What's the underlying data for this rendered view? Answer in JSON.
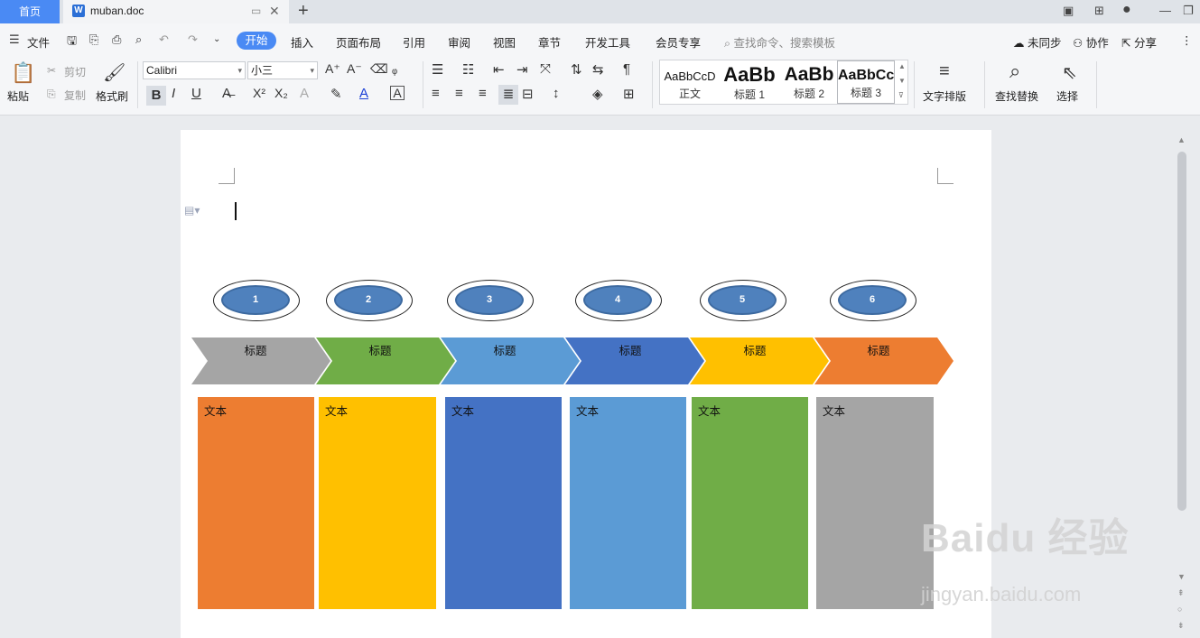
{
  "titlebar": {
    "home_tab": "首页",
    "doc_tab": "muban.doc",
    "doc_icon": "W",
    "new_tab": "+"
  },
  "menu": {
    "file": "文件",
    "tabs": [
      "开始",
      "插入",
      "页面布局",
      "引用",
      "审阅",
      "视图",
      "章节",
      "开发工具",
      "会员专享"
    ],
    "search_placeholder": "查找命令、搜索模板",
    "right": [
      "未同步",
      "协作",
      "分享"
    ]
  },
  "ribbon": {
    "paste": "粘贴",
    "cut": "剪切",
    "copy": "复制",
    "format_painter": "格式刷",
    "font_name": "Calibri",
    "font_size": "小三",
    "styles": [
      {
        "sample": "AaBbCcD",
        "name": "正文"
      },
      {
        "sample": "AaBb",
        "name": "标题 1"
      },
      {
        "sample": "AaBb",
        "name": "标题 2"
      },
      {
        "sample": "AaBbCc",
        "name": "标题 3"
      }
    ],
    "text_layout": "文字排版",
    "find_replace": "查找替换",
    "select": "选择"
  },
  "diagram": {
    "steps": [
      {
        "num": "1",
        "title": "标题",
        "text": "文本"
      },
      {
        "num": "2",
        "title": "标题",
        "text": "文本"
      },
      {
        "num": "3",
        "title": "标题",
        "text": "文本"
      },
      {
        "num": "4",
        "title": "标题",
        "text": "文本"
      },
      {
        "num": "5",
        "title": "标题",
        "text": "文本"
      },
      {
        "num": "6",
        "title": "标题",
        "text": "文本"
      }
    ],
    "chevron_colors": [
      "#a5a5a5",
      "#70ad47",
      "#5b9bd5",
      "#4472c4",
      "#ffc000",
      "#ed7d31"
    ],
    "box_colors": [
      "#ed7d31",
      "#ffc000",
      "#4472c4",
      "#5b9bd5",
      "#70ad47",
      "#a5a5a5"
    ]
  },
  "watermark": {
    "brand": "Baidu 经验",
    "url": "jingyan.baidu.com"
  }
}
